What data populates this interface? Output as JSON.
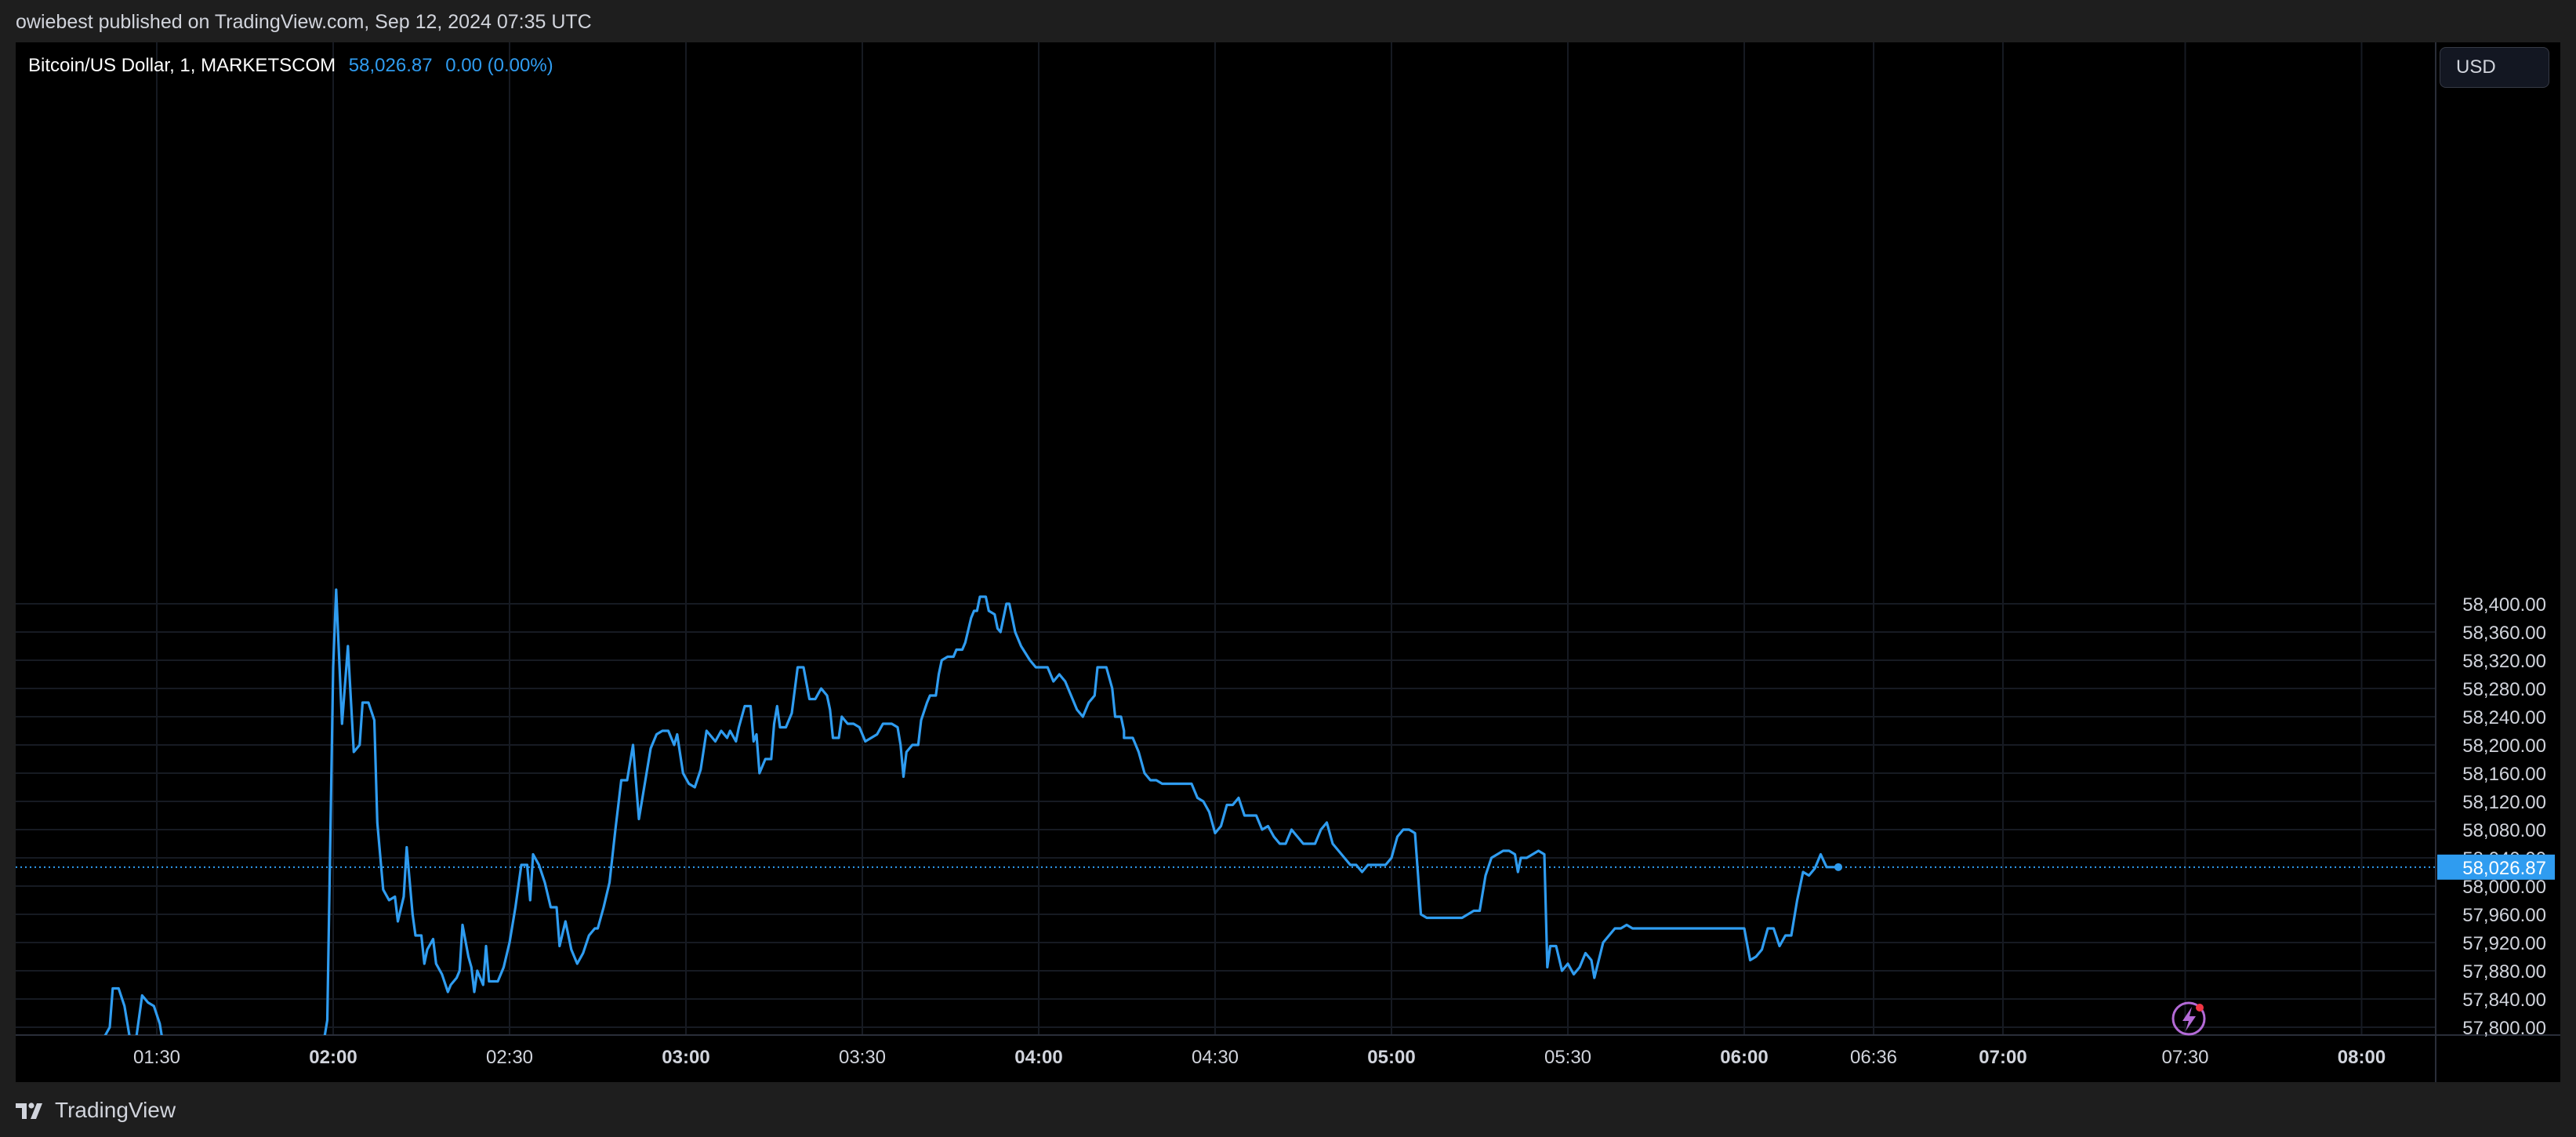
{
  "header": {
    "publish_text": "owiebest published on TradingView.com, Sep 12, 2024 07:35 UTC"
  },
  "legend": {
    "symbol": "Bitcoin/US Dollar, 1, MARKETSCOM",
    "last_price": "58,026.87",
    "change": "0.00 (0.00%)"
  },
  "currency_button": "USD",
  "footer": {
    "brand": "TradingView"
  },
  "colors": {
    "line": "#2f9cf0",
    "background": "#000000",
    "price_tag": "#2f9cf0",
    "grid": "#161a22"
  },
  "icons": {
    "brand": "tradingview-logo-icon",
    "flash": "lightning-bolt-icon"
  },
  "chart_data": {
    "type": "line",
    "title": "Bitcoin/US Dollar, 1, MARKETSCOM",
    "xlabel": "",
    "ylabel": "",
    "ylim": [
      57790,
      58440
    ],
    "grid": true,
    "last_value": 58026.87,
    "last_value_label": "58,026.87",
    "y_ticks": [
      57800,
      57840,
      57880,
      57920,
      57960,
      58000,
      58040,
      58080,
      58120,
      58160,
      58200,
      58240,
      58280,
      58320,
      58360,
      58400
    ],
    "y_tick_labels": [
      "57,800.00",
      "57,840.00",
      "57,880.00",
      "57,920.00",
      "57,960.00",
      "58,000.00",
      "58,040.00",
      "58,080.00",
      "58,120.00",
      "58,160.00",
      "58,200.00",
      "58,240.00",
      "58,280.00",
      "58,320.00",
      "58,360.00",
      "58,400.00"
    ],
    "x_ticks": [
      {
        "label": "01:30",
        "minute": 90,
        "bold": false
      },
      {
        "label": "02:00",
        "minute": 120,
        "bold": true
      },
      {
        "label": "02:30",
        "minute": 150,
        "bold": false
      },
      {
        "label": "03:00",
        "minute": 180,
        "bold": true
      },
      {
        "label": "03:30",
        "minute": 210,
        "bold": false
      },
      {
        "label": "04:00",
        "minute": 240,
        "bold": true
      },
      {
        "label": "04:30",
        "minute": 270,
        "bold": false
      },
      {
        "label": "05:00",
        "minute": 300,
        "bold": true
      },
      {
        "label": "05:30",
        "minute": 330,
        "bold": false
      },
      {
        "label": "06:00",
        "minute": 360,
        "bold": true
      },
      {
        "label": "06:36",
        "minute": 382,
        "bold": false
      },
      {
        "label": "07:00",
        "minute": 404,
        "bold": true
      },
      {
        "label": "07:30",
        "minute": 435,
        "bold": false
      },
      {
        "label": "08:00",
        "minute": 465,
        "bold": true
      }
    ],
    "series": [
      {
        "points": [
          [
            81,
            57785
          ],
          [
            82,
            57800
          ],
          [
            82.5,
            57855
          ],
          [
            83.5,
            57855
          ],
          [
            84.5,
            57830
          ],
          [
            85.5,
            57780
          ],
          [
            86.5,
            57785
          ],
          [
            87.5,
            57845
          ],
          [
            88.5,
            57835
          ],
          [
            89.5,
            57830
          ],
          [
            90.5,
            57805
          ],
          [
            91,
            57780
          ],
          [
            118.5,
            57785
          ],
          [
            119,
            57810
          ],
          [
            120,
            58310
          ],
          [
            120.5,
            58420
          ],
          [
            121.5,
            58230
          ],
          [
            122.5,
            58340
          ],
          [
            123.5,
            58190
          ],
          [
            124.5,
            58200
          ],
          [
            125,
            58260
          ],
          [
            126,
            58260
          ],
          [
            127,
            58235
          ],
          [
            127.5,
            58090
          ],
          [
            128.5,
            57995
          ],
          [
            129.5,
            57980
          ],
          [
            130.5,
            57985
          ],
          [
            131,
            57950
          ],
          [
            132,
            57985
          ],
          [
            132.5,
            58055
          ],
          [
            133.5,
            57960
          ],
          [
            134,
            57930
          ],
          [
            135,
            57930
          ],
          [
            135.5,
            57890
          ],
          [
            136,
            57910
          ],
          [
            137,
            57925
          ],
          [
            137.5,
            57890
          ],
          [
            138.5,
            57875
          ],
          [
            139.5,
            57850
          ],
          [
            140,
            57860
          ],
          [
            141,
            57870
          ],
          [
            141.5,
            57880
          ],
          [
            142,
            57945
          ],
          [
            143,
            57900
          ],
          [
            143.5,
            57885
          ],
          [
            144,
            57850
          ],
          [
            144.5,
            57880
          ],
          [
            145.5,
            57860
          ],
          [
            146,
            57915
          ],
          [
            146.5,
            57865
          ],
          [
            148,
            57865
          ],
          [
            149,
            57885
          ],
          [
            150,
            57920
          ],
          [
            151,
            57970
          ],
          [
            152,
            58030
          ],
          [
            153,
            58030
          ],
          [
            153.5,
            57980
          ],
          [
            154,
            58045
          ],
          [
            155,
            58030
          ],
          [
            156,
            58005
          ],
          [
            157,
            57970
          ],
          [
            158,
            57970
          ],
          [
            158.5,
            57915
          ],
          [
            159.5,
            57950
          ],
          [
            160.5,
            57910
          ],
          [
            161.5,
            57890
          ],
          [
            162.5,
            57905
          ],
          [
            163.5,
            57930
          ],
          [
            164.5,
            57940
          ],
          [
            165,
            57940
          ],
          [
            166,
            57970
          ],
          [
            167,
            58005
          ],
          [
            168,
            58080
          ],
          [
            169,
            58150
          ],
          [
            170,
            58150
          ],
          [
            171,
            58200
          ],
          [
            172,
            58095
          ],
          [
            173,
            58145
          ],
          [
            174,
            58195
          ],
          [
            175,
            58215
          ],
          [
            176,
            58220
          ],
          [
            177,
            58220
          ],
          [
            178,
            58200
          ],
          [
            178.5,
            58215
          ],
          [
            179.5,
            58160
          ],
          [
            180.5,
            58145
          ],
          [
            181.5,
            58140
          ],
          [
            182.5,
            58165
          ],
          [
            183.5,
            58220
          ],
          [
            184.5,
            58210
          ],
          [
            185,
            58205
          ],
          [
            186,
            58220
          ],
          [
            187,
            58210
          ],
          [
            187.5,
            58220
          ],
          [
            188.5,
            58205
          ],
          [
            189,
            58225
          ],
          [
            190,
            58255
          ],
          [
            191,
            58255
          ],
          [
            191.5,
            58205
          ],
          [
            192,
            58215
          ],
          [
            192.5,
            58160
          ],
          [
            193.5,
            58180
          ],
          [
            194.5,
            58180
          ],
          [
            195,
            58230
          ],
          [
            195.5,
            58255
          ],
          [
            196,
            58225
          ],
          [
            197,
            58225
          ],
          [
            198,
            58245
          ],
          [
            199,
            58310
          ],
          [
            200,
            58310
          ],
          [
            201,
            58265
          ],
          [
            202,
            58265
          ],
          [
            203,
            58280
          ],
          [
            204,
            58270
          ],
          [
            204.5,
            58250
          ],
          [
            205,
            58210
          ],
          [
            206,
            58210
          ],
          [
            206.5,
            58240
          ],
          [
            207.5,
            58230
          ],
          [
            208.5,
            58230
          ],
          [
            209.5,
            58225
          ],
          [
            210.5,
            58205
          ],
          [
            211.5,
            58210
          ],
          [
            212.5,
            58215
          ],
          [
            213.5,
            58230
          ],
          [
            215,
            58230
          ],
          [
            216,
            58225
          ],
          [
            216.5,
            58200
          ],
          [
            217,
            58155
          ],
          [
            217.5,
            58190
          ],
          [
            218.5,
            58200
          ],
          [
            219.5,
            58200
          ],
          [
            220,
            58235
          ],
          [
            221,
            58260
          ],
          [
            221.5,
            58270
          ],
          [
            222.5,
            58270
          ],
          [
            223,
            58300
          ],
          [
            223.5,
            58320
          ],
          [
            224.5,
            58325
          ],
          [
            225.5,
            58325
          ],
          [
            226,
            58335
          ],
          [
            227,
            58335
          ],
          [
            227.5,
            58345
          ],
          [
            228.5,
            58380
          ],
          [
            229,
            58390
          ],
          [
            229.5,
            58390
          ],
          [
            230,
            58410
          ],
          [
            231,
            58410
          ],
          [
            231.5,
            58390
          ],
          [
            232.5,
            58385
          ],
          [
            233,
            58365
          ],
          [
            233.5,
            58360
          ],
          [
            234.5,
            58400
          ],
          [
            235,
            58400
          ],
          [
            235.5,
            58380
          ],
          [
            236,
            58360
          ],
          [
            237,
            58340
          ],
          [
            238.5,
            58320
          ],
          [
            239.5,
            58310
          ],
          [
            240.5,
            58310
          ],
          [
            241.5,
            58310
          ],
          [
            242.5,
            58290
          ],
          [
            243.5,
            58300
          ],
          [
            244.5,
            58290
          ],
          [
            245.5,
            58270
          ],
          [
            246.5,
            58250
          ],
          [
            247.5,
            58240
          ],
          [
            248.5,
            58260
          ],
          [
            249.5,
            58270
          ],
          [
            250,
            58310
          ],
          [
            251.5,
            58310
          ],
          [
            252.5,
            58280
          ],
          [
            253,
            58240
          ],
          [
            254,
            58240
          ],
          [
            254.5,
            58220
          ],
          [
            254.5,
            58210
          ],
          [
            256,
            58210
          ],
          [
            257,
            58190
          ],
          [
            258,
            58160
          ],
          [
            259,
            58150
          ],
          [
            260,
            58150
          ],
          [
            261,
            58145
          ],
          [
            263,
            58145
          ],
          [
            264,
            58145
          ],
          [
            265,
            58145
          ],
          [
            266,
            58145
          ],
          [
            267,
            58125
          ],
          [
            268,
            58120
          ],
          [
            269,
            58105
          ],
          [
            270,
            58075
          ],
          [
            271,
            58085
          ],
          [
            272,
            58115
          ],
          [
            273,
            58115
          ],
          [
            274,
            58125
          ],
          [
            275,
            58100
          ],
          [
            276,
            58100
          ],
          [
            277,
            58100
          ],
          [
            278,
            58080
          ],
          [
            279,
            58085
          ],
          [
            280,
            58070
          ],
          [
            281,
            58060
          ],
          [
            282,
            58060
          ],
          [
            283,
            58080
          ],
          [
            284,
            58070
          ],
          [
            285,
            58060
          ],
          [
            286,
            58060
          ],
          [
            287,
            58060
          ],
          [
            288,
            58080
          ],
          [
            289,
            58090
          ],
          [
            290,
            58060
          ],
          [
            291,
            58050
          ],
          [
            292,
            58040
          ],
          [
            293,
            58030
          ],
          [
            294,
            58030
          ],
          [
            295,
            58020
          ],
          [
            296,
            58030
          ],
          [
            297,
            58030
          ],
          [
            298,
            58030
          ],
          [
            299,
            58030
          ],
          [
            300,
            58040
          ],
          [
            301,
            58070
          ],
          [
            302,
            58080
          ],
          [
            303,
            58080
          ],
          [
            304,
            58075
          ],
          [
            305,
            57960
          ],
          [
            306,
            57955
          ],
          [
            307,
            57955
          ],
          [
            308,
            57955
          ],
          [
            309,
            57955
          ],
          [
            310,
            57955
          ],
          [
            311,
            57955
          ],
          [
            312,
            57955
          ],
          [
            313,
            57960
          ],
          [
            314,
            57965
          ],
          [
            315,
            57965
          ],
          [
            316,
            58015
          ],
          [
            317,
            58040
          ],
          [
            318,
            58045
          ],
          [
            319,
            58050
          ],
          [
            320,
            58050
          ],
          [
            321,
            58045
          ],
          [
            321.5,
            58020
          ],
          [
            322,
            58040
          ],
          [
            323,
            58040
          ],
          [
            324,
            58045
          ],
          [
            325,
            58050
          ],
          [
            326,
            58045
          ],
          [
            326.5,
            57885
          ],
          [
            327,
            57915
          ],
          [
            328,
            57915
          ],
          [
            329,
            57880
          ],
          [
            330,
            57890
          ],
          [
            331,
            57875
          ],
          [
            332,
            57885
          ],
          [
            333,
            57905
          ],
          [
            334,
            57895
          ],
          [
            334.5,
            57870
          ],
          [
            336,
            57920
          ],
          [
            337,
            57930
          ],
          [
            338,
            57940
          ],
          [
            339,
            57940
          ],
          [
            340,
            57945
          ],
          [
            341,
            57940
          ],
          [
            345,
            57940
          ],
          [
            350,
            57940
          ],
          [
            355,
            57940
          ],
          [
            358,
            57940
          ],
          [
            360,
            57940
          ],
          [
            361,
            57895
          ],
          [
            362,
            57900
          ],
          [
            363,
            57910
          ],
          [
            364,
            57940
          ],
          [
            365,
            57940
          ],
          [
            366,
            57915
          ],
          [
            367,
            57930
          ],
          [
            368,
            57930
          ],
          [
            369,
            57980
          ],
          [
            370,
            58020
          ],
          [
            371,
            58015
          ],
          [
            372,
            58025
          ],
          [
            373,
            58045
          ],
          [
            374,
            58026.87
          ],
          [
            375,
            58026.87
          ],
          [
            376,
            58026.87
          ]
        ]
      }
    ]
  }
}
